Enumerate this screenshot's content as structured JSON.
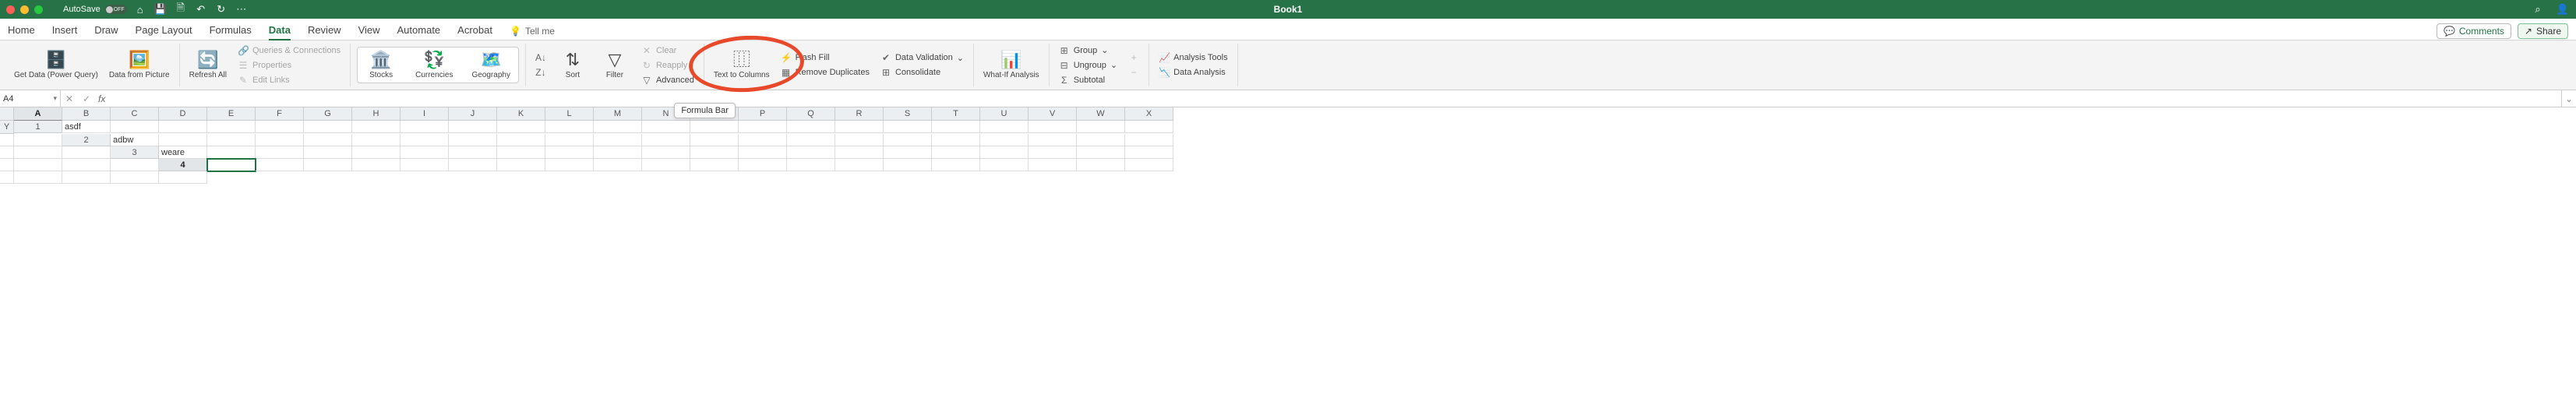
{
  "titlebar": {
    "autosave_label": "AutoSave",
    "autosave_off": "OFF",
    "document_title": "Book1"
  },
  "tabs": {
    "items": [
      "Home",
      "Insert",
      "Draw",
      "Page Layout",
      "Formulas",
      "Data",
      "Review",
      "View",
      "Automate",
      "Acrobat"
    ],
    "active": "Data",
    "tell_me": "Tell me",
    "comments_btn": "Comments",
    "share_btn": "Share"
  },
  "ribbon": {
    "get_data": "Get Data (Power Query)",
    "from_picture": "Data from Picture",
    "refresh_all": "Refresh All",
    "queries": "Queries & Connections",
    "properties": "Properties",
    "edit_links": "Edit Links",
    "stocks": "Stocks",
    "currencies": "Currencies",
    "geography": "Geography",
    "sort": "Sort",
    "filter": "Filter",
    "clear": "Clear",
    "reapply": "Reapply",
    "advanced": "Advanced",
    "text_to_columns": "Text to Columns",
    "flash_fill": "Flash Fill",
    "remove_dup": "Remove Duplicates",
    "data_validation": "Data Validation",
    "consolidate": "Consolidate",
    "what_if": "What-If Analysis",
    "group": "Group",
    "ungroup": "Ungroup",
    "subtotal": "Subtotal",
    "analysis_tools": "Analysis Tools",
    "data_analysis": "Data Analysis"
  },
  "formula_bar": {
    "cell_ref": "A4",
    "tooltip": "Formula Bar"
  },
  "sheet": {
    "columns": [
      "A",
      "B",
      "C",
      "D",
      "E",
      "F",
      "G",
      "H",
      "I",
      "J",
      "K",
      "L",
      "M",
      "N",
      "O",
      "P",
      "Q",
      "R",
      "S",
      "T",
      "U",
      "V",
      "W",
      "X",
      "Y"
    ],
    "rows": [
      {
        "n": 1,
        "cells": [
          "asdf"
        ]
      },
      {
        "n": 2,
        "cells": [
          "adbw"
        ]
      },
      {
        "n": 3,
        "cells": [
          "weare"
        ]
      },
      {
        "n": 4,
        "cells": [
          ""
        ]
      }
    ],
    "active_cell": {
      "row": 4,
      "col": 0
    }
  }
}
